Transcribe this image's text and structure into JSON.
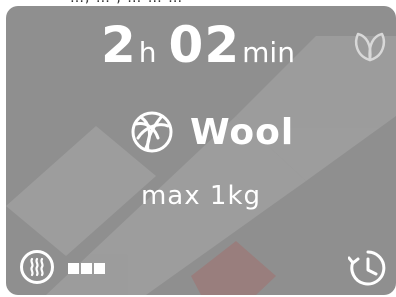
{
  "top_strip": {
    "text": "…, … , … … …"
  },
  "display": {
    "hours_value": "2",
    "hours_unit": "h",
    "minutes_value": "02",
    "minutes_unit": "min"
  },
  "program": {
    "name": "Wool",
    "icon": "wool-icon",
    "max_load": "max 1kg"
  },
  "eco_icon": "leaf-icon",
  "steam": {
    "icon": "steam-icon",
    "level": 3,
    "level_max": 3
  },
  "timer": {
    "icon": "delay-timer-icon"
  },
  "colors": {
    "panel": "#8f8f8f",
    "foreground": "#ffffff",
    "watermark": "#c9302c"
  }
}
